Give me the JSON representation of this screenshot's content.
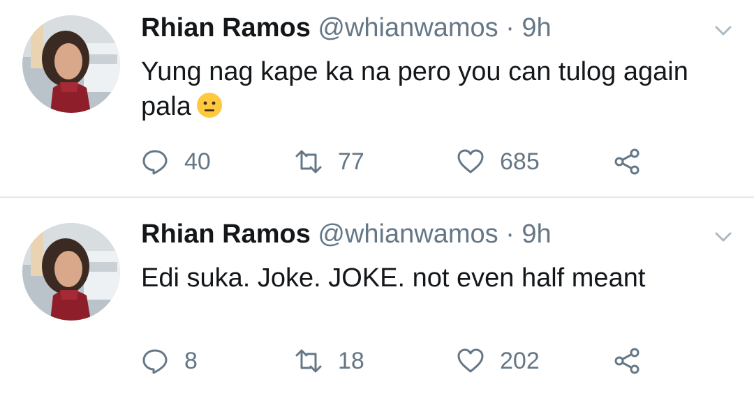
{
  "tweets": [
    {
      "name": "Rhian Ramos",
      "handle": "@whianwamos",
      "separator": "·",
      "time": "9h",
      "text": "Yung nag kape ka na pero you can tulog again pala",
      "emoji": "neutral-face-emoji",
      "replies": "40",
      "retweets": "77",
      "likes": "685"
    },
    {
      "name": "Rhian Ramos",
      "handle": "@whianwamos",
      "separator": "·",
      "time": "9h",
      "text": "Edi suka. Joke. JOKE. not even half meant",
      "replies": "8",
      "retweets": "18",
      "likes": "202"
    }
  ],
  "icons": {
    "reply": "reply-icon",
    "retweet": "retweet-icon",
    "like": "heart-icon",
    "share": "share-icon",
    "caret": "chevron-down-icon"
  },
  "colors": {
    "text": "#14171a",
    "secondary": "#657786",
    "divider": "#e1e8ed",
    "emoji": "#ffc83d"
  }
}
